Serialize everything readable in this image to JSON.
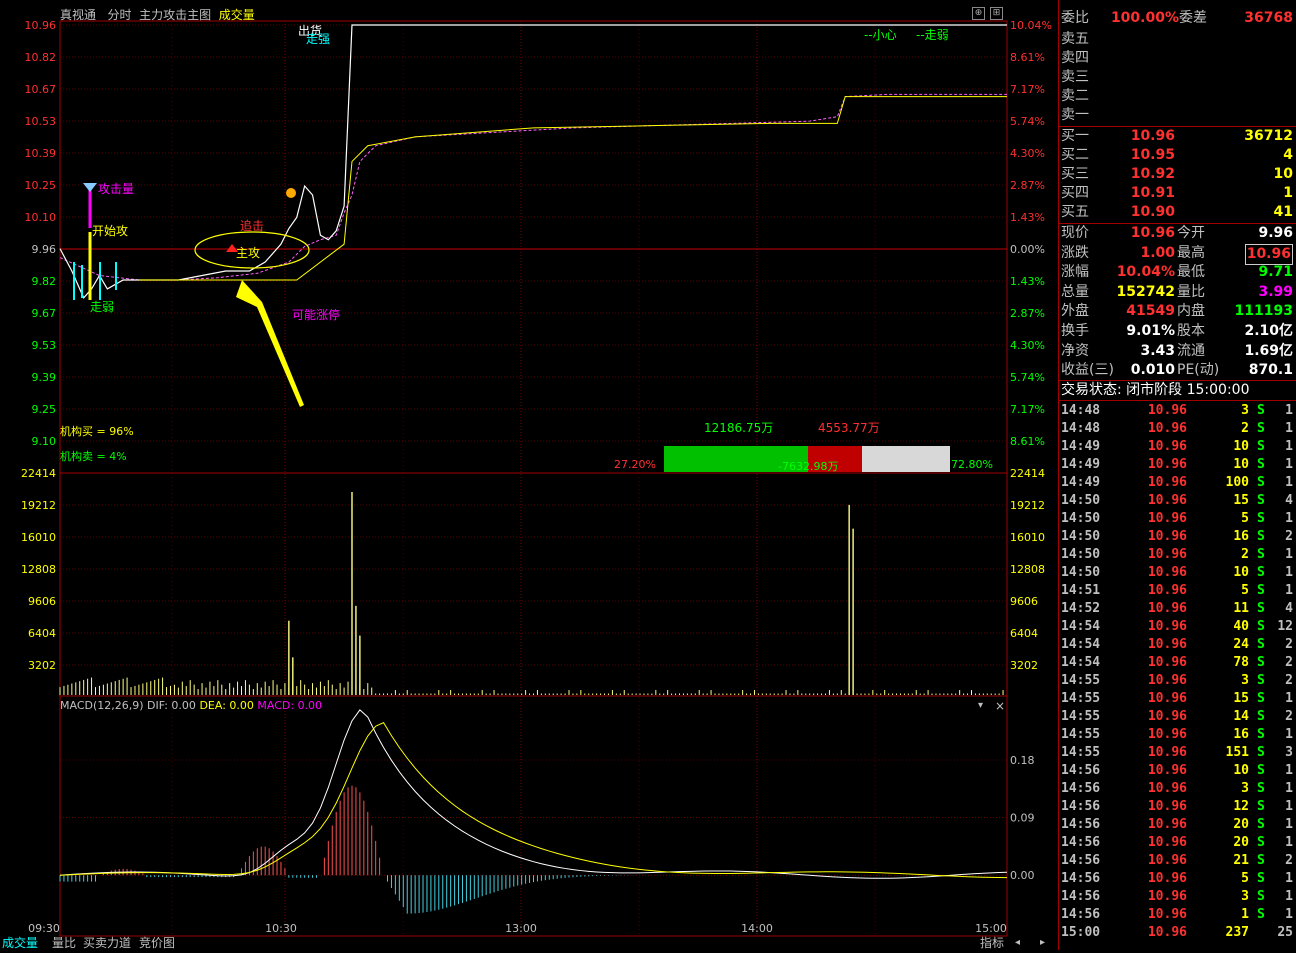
{
  "header": {
    "stock": "真视通",
    "mode": "分时",
    "indicator": "主力攻击主图",
    "volume_label": "成交量"
  },
  "colors": {
    "up": "#ff3030",
    "down": "#00ff00",
    "grid": "#a00000",
    "price": "#ffffff",
    "avg": "#ffff00",
    "vol": "#ffff80"
  },
  "chart_data": [
    {
      "type": "line",
      "title": "",
      "y_ticks_left": [
        "10.96",
        "10.82",
        "10.67",
        "10.53",
        "10.39",
        "10.25",
        "10.10",
        "9.96",
        "9.82",
        "9.67",
        "9.53",
        "9.39",
        "9.25",
        "9.10"
      ],
      "y_ticks_right": [
        "10.04%",
        "8.61%",
        "7.17%",
        "5.74%",
        "4.30%",
        "2.87%",
        "1.43%",
        "0.00%",
        "1.43%",
        "2.87%",
        "4.30%",
        "5.74%",
        "7.17%",
        "8.61%"
      ],
      "x_ticks": [
        "09:30",
        "10:30",
        "13:00",
        "14:00",
        "15:00"
      ],
      "ylim": [
        9.1,
        10.96
      ],
      "prev_close": 9.96,
      "series": [
        {
          "name": "price",
          "x": [
            0,
            3,
            6,
            8,
            10,
            12,
            14,
            16,
            20,
            25,
            30,
            36,
            42,
            48,
            52,
            56,
            58,
            60,
            62,
            64,
            66,
            68,
            70,
            72,
            74,
            76,
            80,
            100,
            150,
            200,
            240
          ],
          "y": [
            9.96,
            9.86,
            9.74,
            9.78,
            9.84,
            9.78,
            9.8,
            9.82,
            9.82,
            9.82,
            9.82,
            9.84,
            9.86,
            9.86,
            9.9,
            9.98,
            10.05,
            10.1,
            10.24,
            10.2,
            10.02,
            10.0,
            10.04,
            10.15,
            10.96,
            10.96,
            10.96,
            10.96,
            10.96,
            10.96,
            10.96
          ]
        },
        {
          "name": "avg",
          "x": [
            0,
            10,
            20,
            30,
            40,
            50,
            58,
            62,
            66,
            70,
            72,
            74,
            76,
            80,
            90,
            110,
            130,
            150,
            170,
            190,
            197,
            199,
            210,
            240
          ],
          "y": [
            9.92,
            9.84,
            9.82,
            9.82,
            9.83,
            9.85,
            9.9,
            9.97,
            10.0,
            10.02,
            10.12,
            10.2,
            10.35,
            10.42,
            10.46,
            10.48,
            10.5,
            10.51,
            10.52,
            10.53,
            10.55,
            10.64,
            10.65,
            10.65
          ]
        }
      ]
    },
    {
      "type": "bar",
      "title": "成交量",
      "y_ticks": [
        "22414",
        "19212",
        "16010",
        "12808",
        "9606",
        "6404",
        "3202"
      ],
      "ylim": [
        0,
        22414
      ],
      "peaks": [
        {
          "x": 58,
          "value": 7500
        },
        {
          "x": 59,
          "value": 3800
        },
        {
          "x": 74,
          "value": 20500
        },
        {
          "x": 75,
          "value": 9000
        },
        {
          "x": 76,
          "value": 6000
        },
        {
          "x": 200,
          "value": 19200
        },
        {
          "x": 201,
          "value": 16800
        }
      ]
    },
    {
      "type": "line",
      "title": "MACD(12,26,9)",
      "y_ticks": [
        "0.18",
        "0.09",
        "0.00"
      ],
      "ylim": [
        -0.07,
        0.28
      ],
      "labels": {
        "dif": "DIF: 0.00",
        "dea": "DEA: 0.00",
        "macd": "MACD: 0.00"
      }
    }
  ],
  "annotations": {
    "gongji": "攻击量",
    "kaishi": "开始攻",
    "zhugong": "主攻",
    "jiji": "追击",
    "keneng": "可能涨停",
    "xiaoxin": "--小心",
    "zouruo": "--走弱",
    "chuhuo": "出货",
    "zouqiang": "走强",
    "zouruo2": "走弱",
    "jigou_mai": "机构买 = 96%",
    "jigou_mai_val": "96%",
    "jigou_mai_v": 96,
    "jigou_mai_label": "机构买",
    "jigou_mai_full": "机构买 = 96%",
    "jigou_sell": "机构卖 = 4%",
    "bar_top_left": "12186.75万",
    "bar_top_right": "4553.77万",
    "bar_mid": "-7632.98万",
    "pct_left": "27.20%",
    "pct_right": "72.80%"
  },
  "panel": {
    "weibi_label": "委比",
    "weibi": "100.00%",
    "weicha_label": "委差",
    "weicha": "36768",
    "sell": [
      {
        "l": "卖五"
      },
      {
        "l": "卖四"
      },
      {
        "l": "卖三"
      },
      {
        "l": "卖二"
      },
      {
        "l": "卖一"
      }
    ],
    "buy": [
      {
        "l": "买一",
        "p": "10.96",
        "v": "36712"
      },
      {
        "l": "买二",
        "p": "10.95",
        "v": "4"
      },
      {
        "l": "买三",
        "p": "10.92",
        "v": "10"
      },
      {
        "l": "买四",
        "p": "10.91",
        "v": "1"
      },
      {
        "l": "买五",
        "p": "10.90",
        "v": "41"
      }
    ],
    "stats": [
      {
        "l1": "现价",
        "v1": "10.96",
        "l2": "今开",
        "v2": "9.96"
      },
      {
        "l1": "涨跌",
        "v1": "1.00",
        "l2": "最高",
        "v2": "10.96"
      },
      {
        "l1": "涨幅",
        "v1": "10.04%",
        "l2": "最低",
        "v2": "9.71"
      },
      {
        "l1": "总量",
        "v1": "152742",
        "l2": "量比",
        "v2": "3.99"
      },
      {
        "l1": "外盘",
        "v1": "41549",
        "l2": "内盘",
        "v2": "111193"
      },
      {
        "l1": "换手",
        "v1": "9.01%",
        "l2": "股本",
        "v2": "2.10亿"
      },
      {
        "l1": "净资",
        "v1": "3.43",
        "l2": "流通",
        "v2": "1.69亿"
      },
      {
        "l1": "收益(三)",
        "v1": "0.010",
        "l2": "PE(动)",
        "v2": "870.1"
      }
    ],
    "status": "交易状态: 闭市阶段 15:00:00",
    "trades": [
      {
        "t": "14:48",
        "p": "10.96",
        "v": "3",
        "d": "S",
        "c": "1"
      },
      {
        "t": "14:48",
        "p": "10.96",
        "v": "2",
        "d": "S",
        "c": "1"
      },
      {
        "t": "14:49",
        "p": "10.96",
        "v": "10",
        "d": "S",
        "c": "1"
      },
      {
        "t": "14:49",
        "p": "10.96",
        "v": "10",
        "d": "S",
        "c": "1"
      },
      {
        "t": "14:49",
        "p": "10.96",
        "v": "100",
        "d": "S",
        "c": "1"
      },
      {
        "t": "14:50",
        "p": "10.96",
        "v": "15",
        "d": "S",
        "c": "4"
      },
      {
        "t": "14:50",
        "p": "10.96",
        "v": "5",
        "d": "S",
        "c": "1"
      },
      {
        "t": "14:50",
        "p": "10.96",
        "v": "16",
        "d": "S",
        "c": "2"
      },
      {
        "t": "14:50",
        "p": "10.96",
        "v": "2",
        "d": "S",
        "c": "1"
      },
      {
        "t": "14:50",
        "p": "10.96",
        "v": "10",
        "d": "S",
        "c": "1"
      },
      {
        "t": "14:51",
        "p": "10.96",
        "v": "5",
        "d": "S",
        "c": "1"
      },
      {
        "t": "14:52",
        "p": "10.96",
        "v": "11",
        "d": "S",
        "c": "4"
      },
      {
        "t": "14:54",
        "p": "10.96",
        "v": "40",
        "d": "S",
        "c": "12"
      },
      {
        "t": "14:54",
        "p": "10.96",
        "v": "24",
        "d": "S",
        "c": "2"
      },
      {
        "t": "14:54",
        "p": "10.96",
        "v": "78",
        "d": "S",
        "c": "2"
      },
      {
        "t": "14:55",
        "p": "10.96",
        "v": "3",
        "d": "S",
        "c": "2"
      },
      {
        "t": "14:55",
        "p": "10.96",
        "v": "15",
        "d": "S",
        "c": "1"
      },
      {
        "t": "14:55",
        "p": "10.96",
        "v": "14",
        "d": "S",
        "c": "2"
      },
      {
        "t": "14:55",
        "p": "10.96",
        "v": "16",
        "d": "S",
        "c": "1"
      },
      {
        "t": "14:55",
        "p": "10.96",
        "v": "151",
        "d": "S",
        "c": "3"
      },
      {
        "t": "14:56",
        "p": "10.96",
        "v": "10",
        "d": "S",
        "c": "1"
      },
      {
        "t": "14:56",
        "p": "10.96",
        "v": "3",
        "d": "S",
        "c": "1"
      },
      {
        "t": "14:56",
        "p": "10.96",
        "v": "12",
        "d": "S",
        "c": "1"
      },
      {
        "t": "14:56",
        "p": "10.96",
        "v": "20",
        "d": "S",
        "c": "1"
      },
      {
        "t": "14:56",
        "p": "10.96",
        "v": "20",
        "d": "S",
        "c": "1"
      },
      {
        "t": "14:56",
        "p": "10.96",
        "v": "21",
        "d": "S",
        "c": "2"
      },
      {
        "t": "14:56",
        "p": "10.96",
        "v": "5",
        "d": "S",
        "c": "1"
      },
      {
        "t": "14:56",
        "p": "10.96",
        "v": "3",
        "d": "S",
        "c": "1"
      },
      {
        "t": "14:56",
        "p": "10.96",
        "v": "1",
        "d": "S",
        "c": "1"
      },
      {
        "t": "15:00",
        "p": "10.96",
        "v": "237",
        "d": "",
        "c": "25"
      }
    ]
  },
  "tabs": [
    "成交量",
    "量比",
    "买卖力道",
    "竞价图"
  ],
  "right_tab": "指标"
}
